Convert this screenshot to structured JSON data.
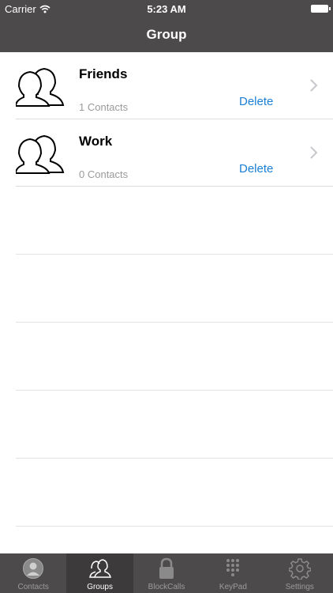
{
  "statusbar": {
    "carrier": "Carrier",
    "time": "5:23 AM"
  },
  "navbar": {
    "title": "Group"
  },
  "groups": [
    {
      "name": "Friends",
      "count": "1 Contacts",
      "delete_label": "Delete"
    },
    {
      "name": "Work",
      "count": "0 Contacts",
      "delete_label": "Delete"
    }
  ],
  "tabs": [
    {
      "label": "Contacts",
      "icon": "person-circle-icon"
    },
    {
      "label": "Groups",
      "icon": "people-icon"
    },
    {
      "label": "BlockCalls",
      "icon": "lock-icon"
    },
    {
      "label": "KeyPad",
      "icon": "keypad-icon"
    },
    {
      "label": "Settings",
      "icon": "gear-icon"
    }
  ],
  "active_tab": "Groups",
  "colors": {
    "bar": "#4d4a4b",
    "accent": "#1a7fd4",
    "active_tab_bg": "#3c3a3b"
  }
}
